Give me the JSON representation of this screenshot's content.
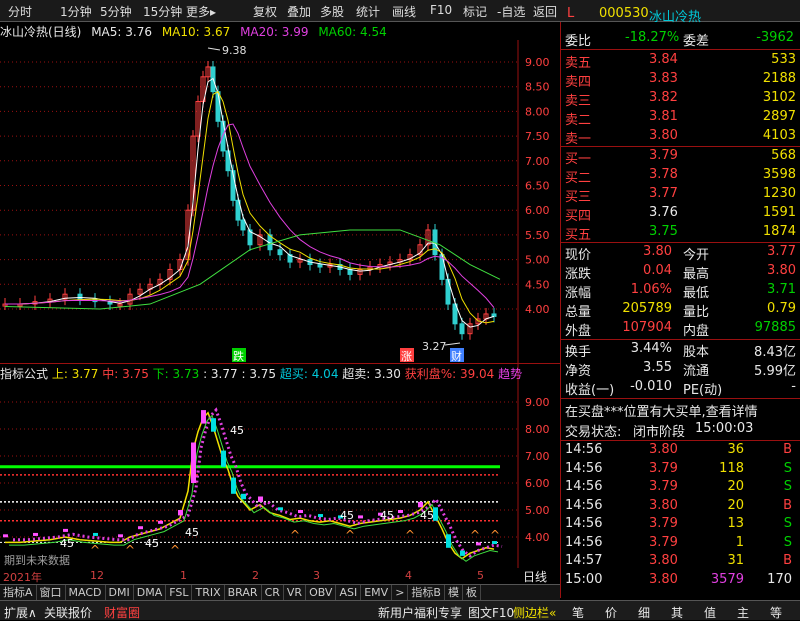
{
  "toolbar": {
    "items": [
      "分时",
      "1分钟",
      "5分钟",
      "15分钟",
      "更多▸",
      "复权",
      "叠加",
      "多股",
      "统计",
      "画线",
      "F10",
      "标记",
      "-自选",
      "返回"
    ]
  },
  "chart_header": {
    "title": "冰山冷热(日线)",
    "ma5": "MA5: 3.76",
    "ma10": "MA10: 3.67",
    "ma20": "MA20: 3.99",
    "ma60": "MA60: 4.54",
    "high_label": "9.38",
    "low_label": "3.27"
  },
  "price_axis": [
    "9.00",
    "8.50",
    "8.00",
    "7.50",
    "7.00",
    "6.50",
    "6.00",
    "5.50",
    "5.00",
    "4.50",
    "4.00"
  ],
  "markers": {
    "die": "跌",
    "zhang": "涨",
    "cai": "财"
  },
  "indicator": {
    "name": "指标公式",
    "up": "上: 3.77",
    "mid": "中: 3.75",
    "down": "下: 3.73",
    "v1": ": 3.77",
    "v2": ": 3.75",
    "buy": "超买: 4.04",
    "sell": "超卖: 3.30",
    "profit": "获利盘%: 39.04",
    "trend": "趋势",
    "no_data": "期到未来数据",
    "star_label": "45"
  },
  "ind_axis": [
    "9.00",
    "8.00",
    "7.00",
    "6.00",
    "5.00",
    "4.00"
  ],
  "x_axis": {
    "labels": [
      "2021年",
      "12",
      "1",
      "2",
      "3",
      "4",
      "5"
    ],
    "right": "日线"
  },
  "bottom_tabs": [
    "指标A",
    "窗口",
    "MACD",
    "DMI",
    "DMA",
    "FSL",
    "TRIX",
    "BRAR",
    "CR",
    "VR",
    "OBV",
    "ASI",
    "EMV",
    ">",
    "指标B",
    "模",
    "板"
  ],
  "status_bar": {
    "left": [
      "扩展∧",
      "关联报价",
      "财富圈"
    ],
    "promo": "新用户福利专享",
    "f10": "图文F10",
    "side": "侧边栏«",
    "icons": [
      "笔",
      "价",
      "细",
      "其",
      "值",
      "主",
      "等"
    ]
  },
  "quote": {
    "code": "000530",
    "name": "冰山冷热",
    "mark": "L",
    "webi_label": "委比",
    "webi": "-18.27%",
    "weicha_label": "委差",
    "weicha": "-3962",
    "asks": [
      {
        "l": "卖五",
        "p": "3.84",
        "v": "533"
      },
      {
        "l": "卖四",
        "p": "3.83",
        "v": "2188"
      },
      {
        "l": "卖三",
        "p": "3.82",
        "v": "3102"
      },
      {
        "l": "卖二",
        "p": "3.81",
        "v": "2897"
      },
      {
        "l": "卖一",
        "p": "3.80",
        "v": "4103"
      }
    ],
    "bids": [
      {
        "l": "买一",
        "p": "3.79",
        "v": "568"
      },
      {
        "l": "买二",
        "p": "3.78",
        "v": "3598"
      },
      {
        "l": "买三",
        "p": "3.77",
        "v": "1230"
      },
      {
        "l": "买四",
        "p": "3.76",
        "v": "1591"
      },
      {
        "l": "买五",
        "p": "3.75",
        "v": "1874"
      }
    ],
    "stats": [
      {
        "a": "现价",
        "av": "3.80",
        "b": "今开",
        "bv": "3.77"
      },
      {
        "a": "涨跌",
        "av": "0.04",
        "b": "最高",
        "bv": "3.80"
      },
      {
        "a": "涨幅",
        "av": "1.06%",
        "b": "最低",
        "bv": "3.71"
      },
      {
        "a": "总量",
        "av": "205789",
        "b": "量比",
        "bv": "0.79"
      },
      {
        "a": "外盘",
        "av": "107904",
        "b": "内盘",
        "bv": "97885"
      }
    ],
    "stats2": [
      {
        "a": "换手",
        "av": "3.44%",
        "b": "股本",
        "bv": "8.43亿"
      },
      {
        "a": "净资",
        "av": "3.55",
        "b": "流通",
        "bv": "5.99亿"
      },
      {
        "a": "收益(一)",
        "av": "-0.010",
        "b": "PE(动)",
        "bv": "-"
      }
    ],
    "notice": "在买盘***位置有大买单,查看详情",
    "state_label": "交易状态:",
    "state": "闭市阶段",
    "state_time": "15:00:03",
    "trades": [
      {
        "t": "14:56",
        "p": "3.80",
        "v": "36",
        "d": "B"
      },
      {
        "t": "14:56",
        "p": "3.79",
        "v": "118",
        "d": "S"
      },
      {
        "t": "14:56",
        "p": "3.79",
        "v": "20",
        "d": "S"
      },
      {
        "t": "14:56",
        "p": "3.80",
        "v": "20",
        "d": "B"
      },
      {
        "t": "14:56",
        "p": "3.79",
        "v": "13",
        "d": "S"
      },
      {
        "t": "14:56",
        "p": "3.79",
        "v": "1",
        "d": "S"
      },
      {
        "t": "14:57",
        "p": "3.80",
        "v": "31",
        "d": "B"
      },
      {
        "t": "15:00",
        "p": "3.80",
        "v": "3579",
        "d": "170"
      }
    ]
  },
  "colors": {
    "up": "#ff4040",
    "down": "#00d000",
    "grid": "#9a1010",
    "ma5": "#ffffff",
    "ma10": "#f0e000",
    "ma20": "#e040e0",
    "ma60": "#40e040"
  }
}
